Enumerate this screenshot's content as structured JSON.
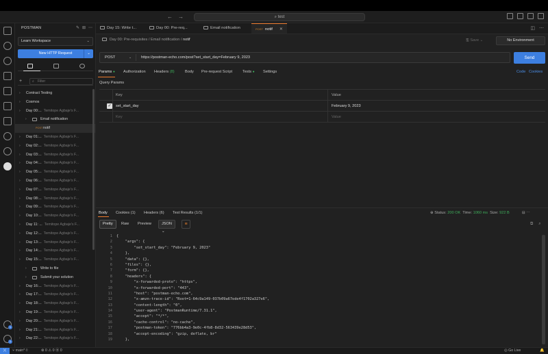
{
  "titlebar": {
    "back_icon": "←",
    "forward_icon": "→",
    "search_text": "test",
    "layout_icons": [
      "sidebar-toggle-icon",
      "panel-toggle-icon",
      "split-icon",
      "layout-icon"
    ]
  },
  "activity_bar": {
    "icons": [
      "explorer-icon",
      "search-icon",
      "source-control-icon",
      "run-debug-icon",
      "extensions-icon",
      "remote-explorer-icon",
      "folder-icon",
      "testing-icon",
      "docker-icon",
      "postman-icon"
    ],
    "account_badge": "1",
    "settings_badge": "1"
  },
  "sidebar": {
    "title": "POSTMAN",
    "workspace": "Learn Workspace",
    "new_request_label": "New HTTP Request",
    "filter_placeholder": "Filter",
    "items": [
      {
        "label": "Contract Testing",
        "indent": 0,
        "type": "collection"
      },
      {
        "label": "Cosmos",
        "indent": 0,
        "type": "collection"
      },
      {
        "label": "Day 00:...",
        "author": "Temitope Agbaje's F...",
        "indent": 0,
        "type": "collection"
      },
      {
        "label": "Email notification",
        "indent": 1,
        "type": "folder"
      },
      {
        "label": "notif",
        "method": "POST",
        "indent": 2,
        "type": "request",
        "selected": true
      },
      {
        "label": "Day 01:...",
        "author": "Temitope Agbaje's F...",
        "indent": 0,
        "type": "collection"
      },
      {
        "label": "Day 02:...",
        "author": "Temitope Agbaje's F...",
        "indent": 0,
        "type": "collection"
      },
      {
        "label": "Day 03:...",
        "author": "Temitope Agbaje's F...",
        "indent": 0,
        "type": "collection"
      },
      {
        "label": "Day 04:...",
        "author": "Temitope Agbaje's F...",
        "indent": 0,
        "type": "collection"
      },
      {
        "label": "Day 05:...",
        "author": "Temitope Agbaje's F...",
        "indent": 0,
        "type": "collection"
      },
      {
        "label": "Day 06:...",
        "author": "Temitope Agbaje's F...",
        "indent": 0,
        "type": "collection"
      },
      {
        "label": "Day 07:...",
        "author": "Temitope Agbaje's F...",
        "indent": 0,
        "type": "collection"
      },
      {
        "label": "Day 08:...",
        "author": "Temitope Agbaje's F...",
        "indent": 0,
        "type": "collection"
      },
      {
        "label": "Day 09:...",
        "author": "Temitope Agbaje's F...",
        "indent": 0,
        "type": "collection"
      },
      {
        "label": "Day 10:...",
        "author": "Temitope Agbaje's F...",
        "indent": 0,
        "type": "collection"
      },
      {
        "label": "Day 11: ...",
        "author": "Temitope Agbaje's F...",
        "indent": 0,
        "type": "collection"
      },
      {
        "label": "Day 12:...",
        "author": "Temitope Agbaje's F...",
        "indent": 0,
        "type": "collection"
      },
      {
        "label": "Day 13:...",
        "author": "Temitope Agbaje's F...",
        "indent": 0,
        "type": "collection"
      },
      {
        "label": "Day 14:...",
        "author": "Temitope Agbaje's F...",
        "indent": 0,
        "type": "collection"
      },
      {
        "label": "Day 15:...",
        "author": "Temitope Agbaje's F...",
        "indent": 0,
        "type": "collection"
      },
      {
        "label": "Write to file",
        "indent": 1,
        "type": "folder"
      },
      {
        "label": "Submit your solution",
        "indent": 1,
        "type": "folder"
      },
      {
        "label": "Day 16:...",
        "author": "Temitope Agbaje's F...",
        "indent": 0,
        "type": "collection"
      },
      {
        "label": "Day 17:...",
        "author": "Temitope Agbaje's F...",
        "indent": 0,
        "type": "collection"
      },
      {
        "label": "Day 18:...",
        "author": "Temitope Agbaje's F...",
        "indent": 0,
        "type": "collection"
      },
      {
        "label": "Day 19:...",
        "author": "Temitope Agbaje's F...",
        "indent": 0,
        "type": "collection"
      },
      {
        "label": "Day 20:...",
        "author": "Temitope Agbaje's F...",
        "indent": 0,
        "type": "collection"
      },
      {
        "label": "Day 21:...",
        "author": "Temitope Agbaje's F...",
        "indent": 0,
        "type": "collection"
      },
      {
        "label": "Day 22:...",
        "author": "Temitope Agbaje's F...",
        "indent": 0,
        "type": "collection"
      }
    ]
  },
  "tabs": [
    {
      "label": "Day 15: Write t...",
      "active": false
    },
    {
      "label": "Day 00: Pre-req...",
      "active": false
    },
    {
      "label": "Email notification",
      "active": false
    },
    {
      "label": "notif",
      "method": "POST",
      "active": true,
      "close": "✕"
    }
  ],
  "breadcrumb": {
    "parts": [
      "Day 00: Pre-requisites",
      "Email notification"
    ],
    "current": "notif",
    "sep": "/"
  },
  "save_label": "Save",
  "environment": "No Environment",
  "request": {
    "method": "POST",
    "url": "https://postman-echo.com/post?set_start_day=February 9, 2023",
    "send_label": "Send"
  },
  "request_tabs": [
    {
      "label": "Params",
      "dot": "●",
      "active": true
    },
    {
      "label": "Authorization"
    },
    {
      "label": "Headers",
      "count": "(8)"
    },
    {
      "label": "Body"
    },
    {
      "label": "Pre-request Script"
    },
    {
      "label": "Tests",
      "dot": "●"
    },
    {
      "label": "Settings"
    }
  ],
  "code_link": "Code",
  "cookies_link": "Cookies",
  "query_params": {
    "title": "Query Params",
    "headers": [
      "Key",
      "Value"
    ],
    "rows": [
      {
        "key": "set_start_day",
        "value": "February 9, 2023",
        "checked": true
      }
    ],
    "placeholder_key": "Key",
    "placeholder_value": "Value"
  },
  "response_tabs": [
    {
      "label": "Body",
      "active": true
    },
    {
      "label": "Cookies",
      "count": "(1)"
    },
    {
      "label": "Headers",
      "count": "(6)"
    },
    {
      "label": "Test Results",
      "count": "(1/1)"
    }
  ],
  "response_status": {
    "status_label": "Status:",
    "status_value": "200 OK",
    "time_label": "Time:",
    "time_value": "1060 ms",
    "size_label": "Size:",
    "size_value": "922 B"
  },
  "view_modes": [
    "Pretty",
    "Raw",
    "Preview"
  ],
  "format": "JSON",
  "response_body": [
    "{",
    "    \"args\": {",
    "        \"set_start_day\": \"February 9, 2023\"",
    "    },",
    "    \"data\": {},",
    "    \"files\": {},",
    "    \"form\": {},",
    "    \"headers\": {",
    "        \"x-forwarded-proto\": \"https\",",
    "        \"x-forwarded-port\": \"443\",",
    "        \"host\": \"postman-echo.com\",",
    "        \"x-amzn-trace-id\": \"Root=1-64c9a149-037b09a67ede4f1702a327e6\",",
    "        \"content-length\": \"0\",",
    "        \"user-agent\": \"PostmanRuntime/7.31.1\",",
    "        \"accept\": \"*/*\",",
    "        \"cache-control\": \"no-cache\",",
    "        \"postman-token\": \"776bb4a3-9e0c-4fb8-8d32-563439e28d53\",",
    "        \"accept-encoding\": \"gzip, deflate, br\"",
    "    },"
  ],
  "statusbar": {
    "branch": "main*",
    "sync_icon": "⟳",
    "errors": "0",
    "warnings": "0",
    "remote": "0",
    "go_live": "Go Live"
  }
}
